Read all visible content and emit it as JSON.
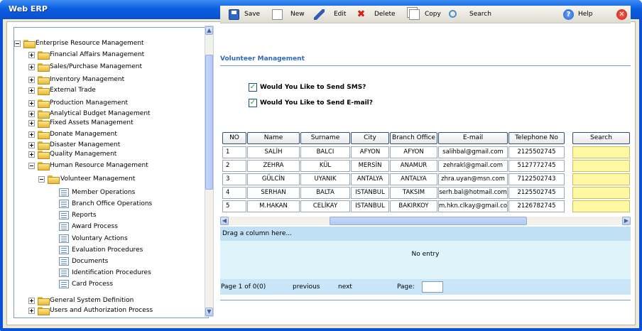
{
  "window": {
    "title": "Web ERP"
  },
  "tree": {
    "root": "Enterprise Resource Management",
    "modules": [
      "Financial Affairs Management",
      "Sales/Purchase Management",
      "Inventory Management",
      "External Trade",
      "Production Management",
      "Analytical Budget Management",
      "Fixed Assets Management",
      "Donate Management",
      "Disaster Management",
      "Quality Management",
      "Human Resource Management"
    ],
    "sub_module": "Volunteer Management",
    "leaves": [
      "Member Operations",
      "Branch Office Operations",
      "Reports",
      "Award Process",
      "Voluntary Actions",
      "Evaluation Procedures",
      "Documents",
      "Identification Procedures",
      "Card Process"
    ],
    "bottom_modules": [
      "General System Definition",
      "Users and Authorization Process"
    ]
  },
  "toolbar": {
    "save": "Save",
    "new": "New",
    "edit": "Edit",
    "delete": "Delete",
    "copy": "Copy",
    "search": "Search",
    "help": "Help",
    "help_glyph": "?",
    "close_glyph": "✕",
    "delete_glyph": "✖"
  },
  "section_title": "Volunteer Management",
  "options": {
    "sms": "Would You Like to Send SMS?",
    "email": "Would You Like to Send E-mail?",
    "check_glyph": "✓"
  },
  "grid": {
    "columns": [
      "NO",
      "Name",
      "Surname",
      "City",
      "Branch Office",
      "E-mail",
      "Telephone No"
    ],
    "search_button": "Search",
    "rows": [
      [
        "1",
        "SALİH",
        "BALCI",
        "AFYON",
        "AFYON",
        "salihbal@gmail.com",
        "2125502745"
      ],
      [
        "2",
        "ZEHRA",
        "KÜL",
        "MERSİN",
        "ANAMUR",
        "zehrakl@gmail.com",
        "5127772745"
      ],
      [
        "3",
        "GÜLCİN",
        "UYANIK",
        "ANTALYA",
        "ANTALYA",
        "zhra.uyan@msn.com",
        "7122502743"
      ],
      [
        "4",
        "SERHAN",
        "BALTA",
        "ISTANBUL",
        "TAKSIM",
        "serh.bal@hotmail.com",
        "2125502745"
      ],
      [
        "5",
        "M.HAKAN",
        "CELİKAY",
        "ISTANBUL",
        "BAKIRKOY",
        "m.hkn.clkay@gmail.com",
        "2126782745"
      ]
    ]
  },
  "drag_hint": "Drag a column here...",
  "empty_message": "No entry",
  "pager": {
    "status": "Page 1 of 0(0)",
    "previous": "previous",
    "next": "next",
    "page_label": "Page:"
  },
  "scroll": {
    "up": "▲",
    "down": "▼",
    "left": "◀",
    "right": "▶"
  }
}
